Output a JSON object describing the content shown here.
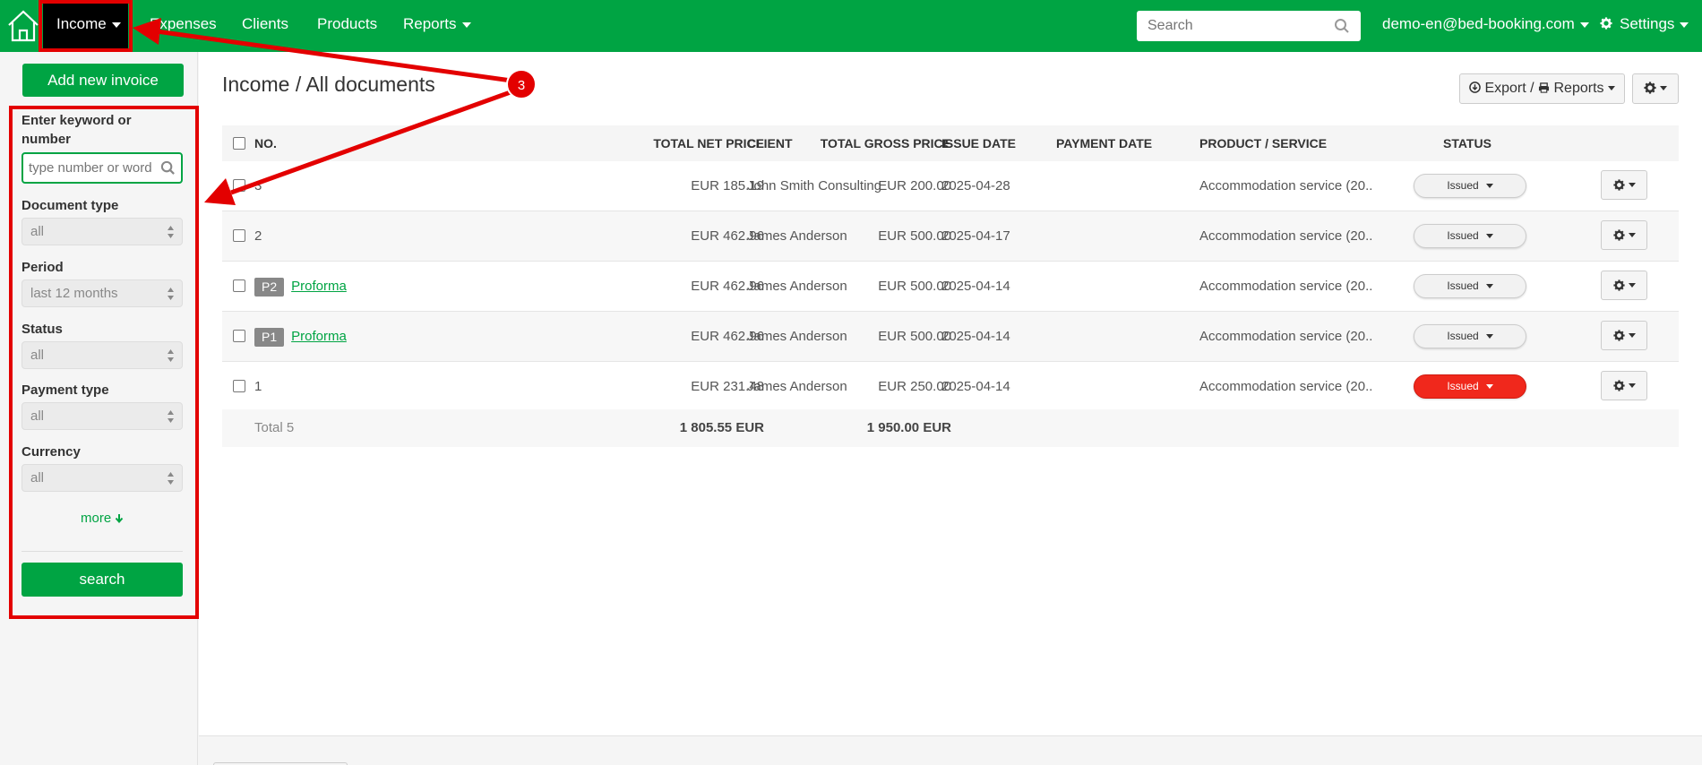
{
  "nav": {
    "items": [
      {
        "label": "Income",
        "active": true
      },
      {
        "label": "Expenses"
      },
      {
        "label": "Clients"
      },
      {
        "label": "Products"
      },
      {
        "label": "Reports"
      }
    ],
    "search_placeholder": "Search",
    "user_email": "demo-en@bed-booking.com",
    "settings_label": "Settings"
  },
  "sidebar": {
    "add_button": "Add new invoice",
    "keyword_label": "Enter keyword or number",
    "keyword_placeholder": "type number or word",
    "filters": [
      {
        "label": "Document type",
        "value": "all"
      },
      {
        "label": "Period",
        "value": "last 12 months"
      },
      {
        "label": "Status",
        "value": "all"
      },
      {
        "label": "Payment type",
        "value": "all"
      },
      {
        "label": "Currency",
        "value": "all"
      }
    ],
    "more_link": "more",
    "search_button": "search"
  },
  "main": {
    "title": "Income / All documents",
    "export_label": "Export / ",
    "reports_label": "Reports",
    "columns": [
      "NO.",
      "TOTAL NET PRICE",
      "TOTAL GROSS PRICE",
      "CLIENT",
      "ISSUE DATE",
      "PAYMENT DATE",
      "PRODUCT / SERVICE",
      "STATUS"
    ],
    "rows": [
      {
        "no": "3",
        "badge": "",
        "link": "",
        "net": "EUR 185.19",
        "gross": "EUR 200.00",
        "client": "John Smith Consulting",
        "issue_date": "2025-04-28",
        "payment_date": "",
        "product": "Accommodation service (20..",
        "status": "Issued",
        "status_color": "gray"
      },
      {
        "no": "2",
        "badge": "",
        "link": "",
        "net": "EUR 462.96",
        "gross": "EUR 500.00",
        "client": "James Anderson",
        "issue_date": "2025-04-17",
        "payment_date": "",
        "product": "Accommodation service (20..",
        "status": "Issued",
        "status_color": "gray"
      },
      {
        "no": "",
        "badge": "P2",
        "link": "Proforma",
        "net": "EUR 462.96",
        "gross": "EUR 500.00",
        "client": "James Anderson",
        "issue_date": "2025-04-14",
        "payment_date": "",
        "product": "Accommodation service (20..",
        "status": "Issued",
        "status_color": "gray"
      },
      {
        "no": "",
        "badge": "P1",
        "link": "Proforma",
        "net": "EUR 462.96",
        "gross": "EUR 500.00",
        "client": "James Anderson",
        "issue_date": "2025-04-14",
        "payment_date": "",
        "product": "Accommodation service (20..",
        "status": "Issued",
        "status_color": "gray"
      },
      {
        "no": "1",
        "badge": "",
        "link": "",
        "net": "EUR 231.48",
        "gross": "EUR 250.00",
        "client": "James Anderson",
        "issue_date": "2025-04-14",
        "payment_date": "",
        "product": "Accommodation service (20..",
        "status": "Issued",
        "status_color": "red"
      }
    ],
    "total_label": "Total 5",
    "total_net": "1 805.55 EUR",
    "total_gross": "1 950.00 EUR"
  },
  "annotation": {
    "step_number": "3",
    "color": "#e30000"
  },
  "colors": {
    "brand": "#00a443",
    "status_red": "#f0281c"
  }
}
